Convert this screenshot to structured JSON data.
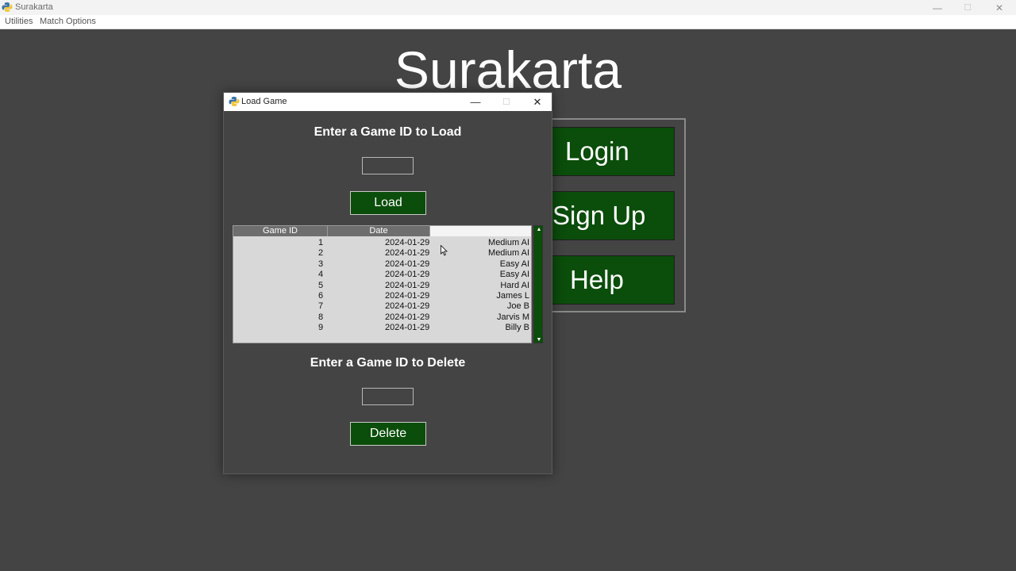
{
  "window": {
    "title": "Surakarta",
    "controls": {
      "minimize": "—",
      "maximize": "☐",
      "close": "✕"
    }
  },
  "menubar": {
    "items": [
      "Utilities",
      "Match Options"
    ]
  },
  "main": {
    "title": "Surakarta",
    "buttons": [
      "Login",
      "Sign Up",
      "Help"
    ]
  },
  "dialog": {
    "title": "Load Game",
    "controls": {
      "minimize": "—",
      "maximize": "☐",
      "close": "✕"
    },
    "load_heading": "Enter a Game ID to Load",
    "load_input_value": "",
    "load_button": "Load",
    "table": {
      "headers": [
        "Game ID",
        "Date",
        ""
      ],
      "rows": [
        {
          "id": "1",
          "date": "2024-01-29",
          "opponent": "Medium AI"
        },
        {
          "id": "2",
          "date": "2024-01-29",
          "opponent": "Medium AI"
        },
        {
          "id": "3",
          "date": "2024-01-29",
          "opponent": "Easy AI"
        },
        {
          "id": "4",
          "date": "2024-01-29",
          "opponent": "Easy AI"
        },
        {
          "id": "5",
          "date": "2024-01-29",
          "opponent": "Hard AI"
        },
        {
          "id": "6",
          "date": "2024-01-29",
          "opponent": "James L"
        },
        {
          "id": "7",
          "date": "2024-01-29",
          "opponent": "Joe B"
        },
        {
          "id": "8",
          "date": "2024-01-29",
          "opponent": "Jarvis M"
        },
        {
          "id": "9",
          "date": "2024-01-29",
          "opponent": "Billy B"
        }
      ]
    },
    "delete_heading": "Enter a Game ID to Delete",
    "delete_input_value": "",
    "delete_button": "Delete"
  },
  "colors": {
    "background": "#444444",
    "button_green": "#0b4d0b",
    "table_bg": "#d8d8d8",
    "header_bg": "#6e6e6e"
  },
  "icons": [
    "python-icon",
    "minimize-icon",
    "maximize-icon",
    "close-icon",
    "scroll-up-arrow-icon",
    "scroll-down-arrow-icon",
    "cursor-icon"
  ]
}
